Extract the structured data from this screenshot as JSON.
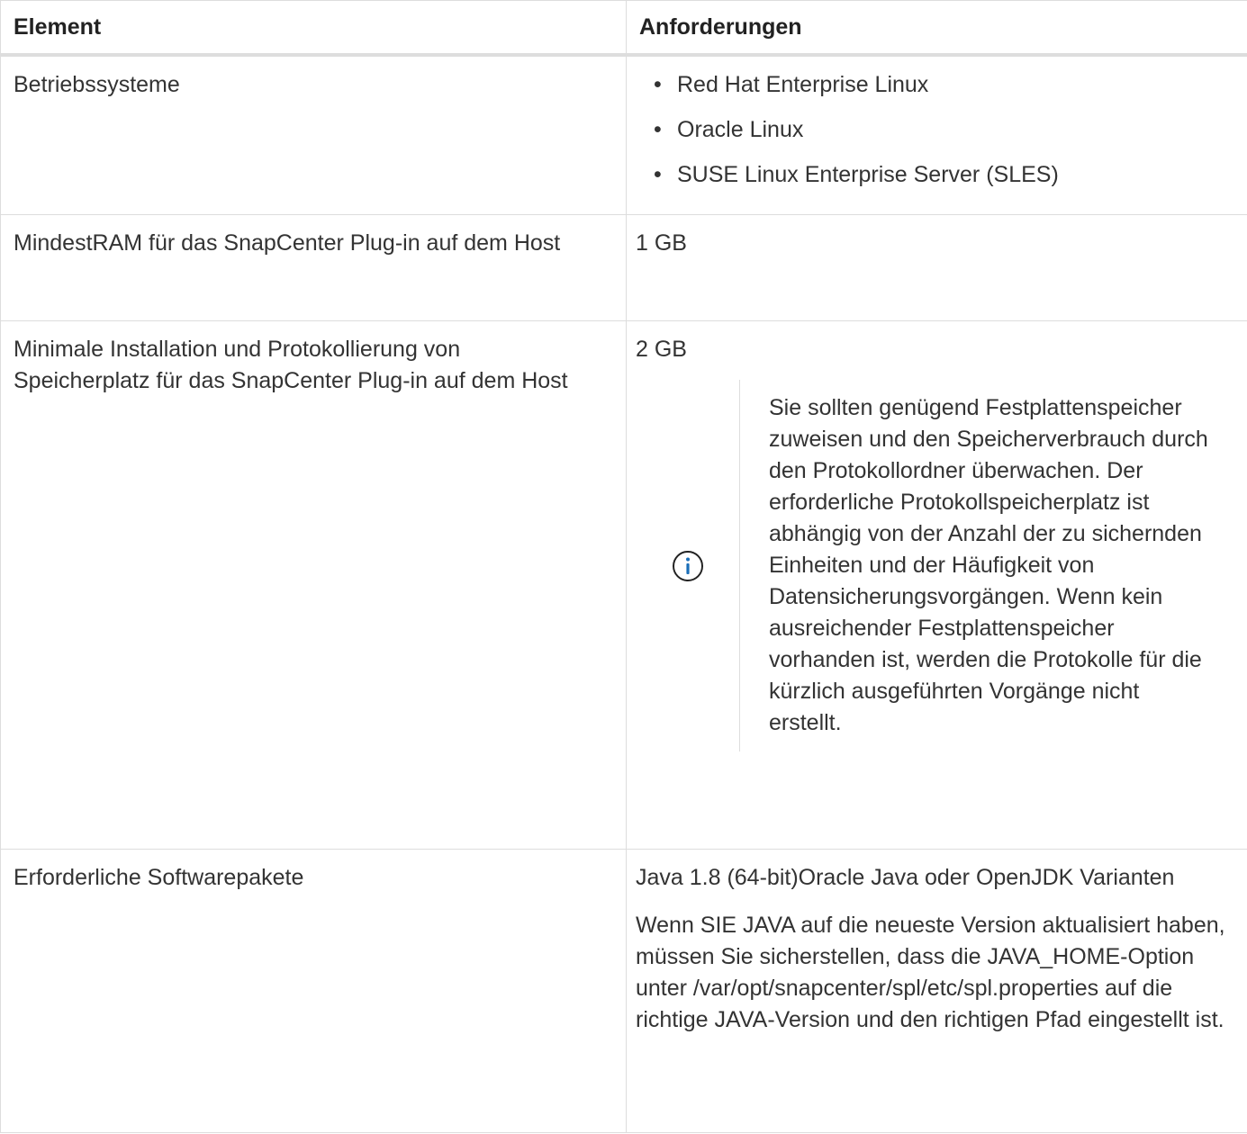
{
  "table": {
    "headers": {
      "element": "Element",
      "requirements": "Anforderungen"
    },
    "rows": [
      {
        "element": "Betriebssysteme",
        "os_list": [
          "Red Hat Enterprise Linux",
          "Oracle Linux",
          "SUSE Linux Enterprise Server (SLES)"
        ]
      },
      {
        "element": "MindestRAM für das SnapCenter Plug-in auf dem Host",
        "requirement": "1 GB"
      },
      {
        "element": "Minimale Installation und Protokollierung von Speicherplatz für das SnapCenter Plug-in auf dem Host",
        "requirement": "2 GB",
        "note_icon": "info-circle-icon",
        "note": "Sie sollten genügend Festplattenspeicher zuweisen und den Speicherverbrauch durch den Protokollordner überwachen. Der erforderliche Protokollspeicherplatz ist abhängig von der Anzahl der zu sichernden Einheiten und der Häufigkeit von Datensicherungsvorgängen. Wenn kein ausreichender Festplattenspeicher vorhanden ist, werden die Protokolle für die kürzlich ausgeführten Vorgänge nicht erstellt."
      },
      {
        "element": "Erforderliche Softwarepakete",
        "requirement": "Java 1.8 (64-bit)Oracle Java oder OpenJDK Varianten",
        "detail": "Wenn SIE JAVA auf die neueste Version aktualisiert haben, müssen Sie sicherstellen, dass die JAVA_HOME-Option unter /var/opt/snapcenter/spl/etc/spl.properties auf die richtige JAVA-Version und den richtigen Pfad eingestellt ist."
      }
    ]
  },
  "colors": {
    "text": "#333333",
    "border": "#dddddd",
    "info_icon": "#1a6eb8"
  }
}
